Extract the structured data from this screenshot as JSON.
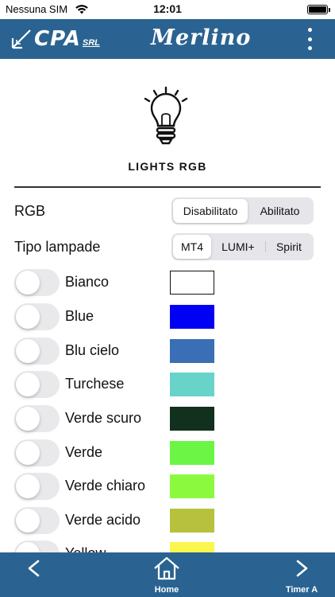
{
  "status_bar": {
    "carrier": "Nessuna SIM",
    "time": "12:01",
    "icons": [
      "wifi-icon",
      "battery-icon"
    ]
  },
  "header": {
    "logo_text": "CPA",
    "logo_suffix": "SRL",
    "title": "Merlino",
    "menu_icon": "more-vertical-icon",
    "background": "#2a6391"
  },
  "page": {
    "icon": "lightbulb-icon",
    "heading": "LIGHTS RGB"
  },
  "rgb_mode": {
    "label": "RGB",
    "options": [
      "Disabilitato",
      "Abilitato"
    ],
    "selected": "Disabilitato"
  },
  "lamp_type": {
    "label": "Tipo lampade",
    "options": [
      "MT4",
      "LUMI+",
      "Spirit"
    ],
    "selected": "MT4"
  },
  "colors": [
    {
      "name": "Bianco",
      "hex": "#ffffff",
      "enabled": false
    },
    {
      "name": "Blue",
      "hex": "#0000f5",
      "enabled": false
    },
    {
      "name": "Blu cielo",
      "hex": "#3a6fb5",
      "enabled": false
    },
    {
      "name": "Turchese",
      "hex": "#67d3c9",
      "enabled": false
    },
    {
      "name": "Verde scuro",
      "hex": "#11301e",
      "enabled": false
    },
    {
      "name": "Verde",
      "hex": "#6cf545",
      "enabled": false
    },
    {
      "name": "Verde chiaro",
      "hex": "#8bfa3f",
      "enabled": false
    },
    {
      "name": "Verde acido",
      "hex": "#b8c13d",
      "enabled": false
    },
    {
      "name": "Yellow",
      "hex": "#fcf550",
      "enabled": false
    }
  ],
  "bottom_bar": {
    "back_icon": "chevron-left-icon",
    "home_icon": "home-icon",
    "home_label": "Home",
    "next_icon": "chevron-right-icon",
    "next_label": "Timer A"
  }
}
